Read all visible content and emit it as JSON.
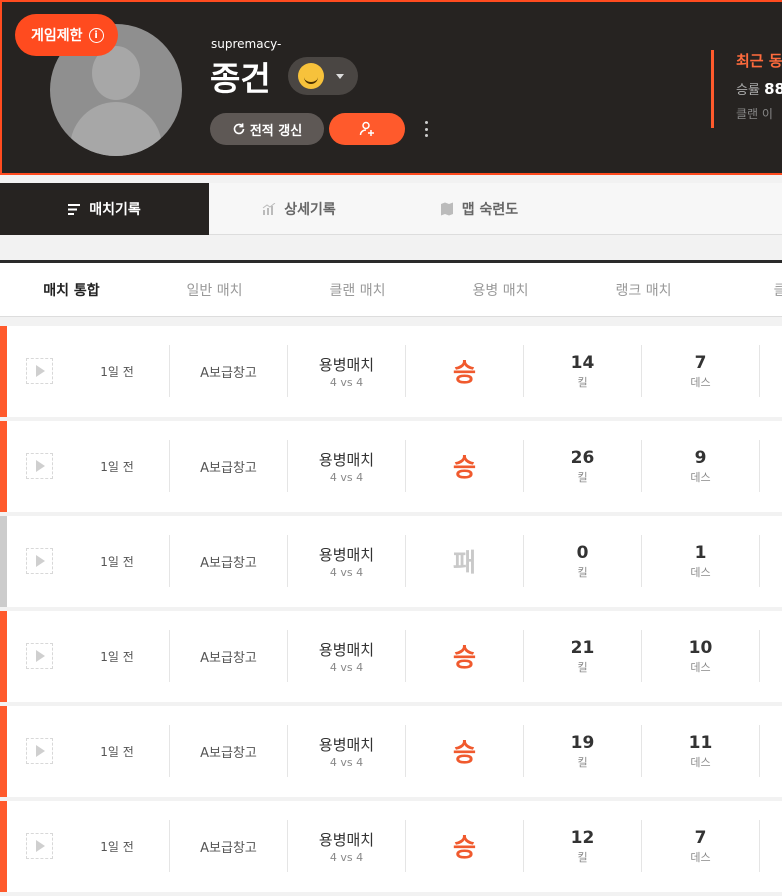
{
  "header": {
    "restrict_badge": "게임제한",
    "user_id": "supremacy-",
    "nickname": "종건",
    "refresh_label": "전적 갱신",
    "recent_title": "최근 동",
    "recent_win_label": "승률",
    "recent_win_value": "88",
    "recent_clan": "클랜 이"
  },
  "tabs": [
    {
      "label": "매치기록",
      "icon": "list-icon"
    },
    {
      "label": "상세기록",
      "icon": "stats-icon"
    },
    {
      "label": "맵 숙련도",
      "icon": "map-icon"
    }
  ],
  "sub_tabs": [
    "매치 통합",
    "일반 매치",
    "클랜 매치",
    "용병 매치",
    "랭크 매치",
    "클랜"
  ],
  "kill_unit": "킬",
  "death_unit": "데스",
  "matches": [
    {
      "time": "1일 전",
      "map": "A보급창고",
      "mode": "용병매치",
      "vs": "4 vs 4",
      "result": "승",
      "kills": "14",
      "deaths": "7"
    },
    {
      "time": "1일 전",
      "map": "A보급창고",
      "mode": "용병매치",
      "vs": "4 vs 4",
      "result": "승",
      "kills": "26",
      "deaths": "9"
    },
    {
      "time": "1일 전",
      "map": "A보급창고",
      "mode": "용병매치",
      "vs": "4 vs 4",
      "result": "패",
      "kills": "0",
      "deaths": "1"
    },
    {
      "time": "1일 전",
      "map": "A보급창고",
      "mode": "용병매치",
      "vs": "4 vs 4",
      "result": "승",
      "kills": "21",
      "deaths": "10"
    },
    {
      "time": "1일 전",
      "map": "A보급창고",
      "mode": "용병매치",
      "vs": "4 vs 4",
      "result": "승",
      "kills": "19",
      "deaths": "11"
    },
    {
      "time": "1일 전",
      "map": "A보급창고",
      "mode": "용병매치",
      "vs": "4 vs 4",
      "result": "승",
      "kills": "12",
      "deaths": "7"
    }
  ],
  "colors": {
    "accent": "#ff5a2c",
    "header_bg": "#262321",
    "lose": "#cccccc"
  }
}
